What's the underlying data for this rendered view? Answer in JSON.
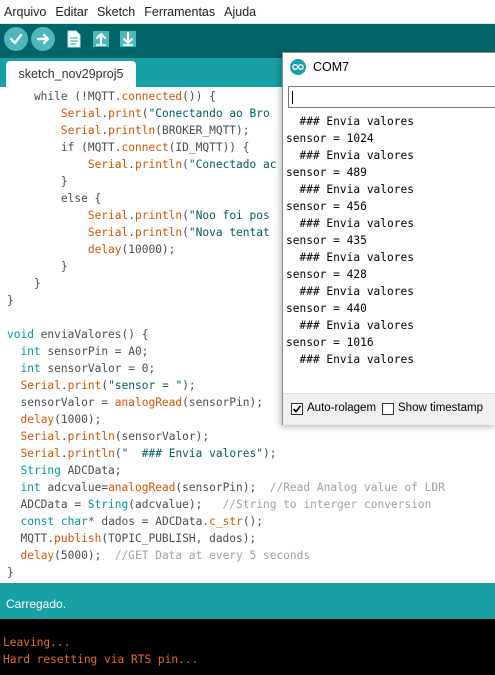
{
  "menu": [
    "Arquivo",
    "Editar",
    "Sketch",
    "Ferramentas",
    "Ajuda"
  ],
  "toolbar": {
    "verify_icon": "check-icon",
    "upload_icon": "arrow-right-icon",
    "new_icon": "document-icon",
    "open_icon": "arrow-up-icon",
    "save_icon": "arrow-down-icon"
  },
  "tab": {
    "label": "sketch_nov29proj5"
  },
  "code": [
    [
      [
        "    while (!",
        ""
      ],
      [
        "MQTT",
        "t"
      ],
      [
        ".",
        ""
      ],
      [
        "connected",
        "fn"
      ],
      [
        "()) {",
        ""
      ]
    ],
    [
      [
        "        ",
        ""
      ],
      [
        "Serial",
        "fn"
      ],
      [
        ".",
        ""
      ],
      [
        "print",
        "fn"
      ],
      [
        "(",
        ""
      ],
      [
        "\"Conectando ao Bro",
        "str"
      ]
    ],
    [
      [
        "        ",
        ""
      ],
      [
        "Serial",
        "fn"
      ],
      [
        ".",
        ""
      ],
      [
        "println",
        "fn"
      ],
      [
        "(BROKER_MQTT);",
        ""
      ]
    ],
    [
      [
        "        if (",
        ""
      ],
      [
        "MQTT",
        "t"
      ],
      [
        ".",
        ""
      ],
      [
        "connect",
        "fn"
      ],
      [
        "(ID_MQTT)) {",
        ""
      ]
    ],
    [
      [
        "            ",
        ""
      ],
      [
        "Serial",
        "fn"
      ],
      [
        ".",
        ""
      ],
      [
        "println",
        "fn"
      ],
      [
        "(",
        ""
      ],
      [
        "\"Conectado ac",
        "str"
      ]
    ],
    [
      [
        "        }",
        ""
      ]
    ],
    [
      [
        "        else {",
        ""
      ]
    ],
    [
      [
        "            ",
        ""
      ],
      [
        "Serial",
        "fn"
      ],
      [
        ".",
        ""
      ],
      [
        "println",
        "fn"
      ],
      [
        "(",
        ""
      ],
      [
        "\"Noo foi pos",
        "str"
      ]
    ],
    [
      [
        "            ",
        ""
      ],
      [
        "Serial",
        "fn"
      ],
      [
        ".",
        ""
      ],
      [
        "println",
        "fn"
      ],
      [
        "(",
        ""
      ],
      [
        "\"Nova tentat",
        "str"
      ]
    ],
    [
      [
        "            ",
        ""
      ],
      [
        "delay",
        "fn"
      ],
      [
        "(10000);",
        ""
      ]
    ],
    [
      [
        "        }",
        ""
      ]
    ],
    [
      [
        "    }",
        ""
      ]
    ],
    [
      [
        "}",
        ""
      ]
    ],
    [
      [
        "",
        ""
      ]
    ],
    [
      [
        "void",
        "kw"
      ],
      [
        " enviaValores() {",
        ""
      ]
    ],
    [
      [
        "  ",
        ""
      ],
      [
        "int",
        "kw"
      ],
      [
        " sensorPin = A0;",
        ""
      ]
    ],
    [
      [
        "  ",
        ""
      ],
      [
        "int",
        "kw"
      ],
      [
        " sensorValor = 0;",
        ""
      ]
    ],
    [
      [
        "  ",
        ""
      ],
      [
        "Serial",
        "fn"
      ],
      [
        ".",
        ""
      ],
      [
        "print",
        "fn"
      ],
      [
        "(",
        ""
      ],
      [
        "\"sensor = \"",
        "str"
      ],
      [
        ");",
        ""
      ]
    ],
    [
      [
        "  sensorValor = ",
        ""
      ],
      [
        "analogRead",
        "fn"
      ],
      [
        "(sensorPin);",
        ""
      ]
    ],
    [
      [
        "  ",
        ""
      ],
      [
        "delay",
        "fn"
      ],
      [
        "(1000);",
        ""
      ]
    ],
    [
      [
        "  ",
        ""
      ],
      [
        "Serial",
        "fn"
      ],
      [
        ".",
        ""
      ],
      [
        "println",
        "fn"
      ],
      [
        "(sensorValor);",
        ""
      ]
    ],
    [
      [
        "  ",
        ""
      ],
      [
        "Serial",
        "fn"
      ],
      [
        ".",
        ""
      ],
      [
        "println",
        "fn"
      ],
      [
        "(",
        ""
      ],
      [
        "\"  ### Envia valores\"",
        "str"
      ],
      [
        ");",
        ""
      ]
    ],
    [
      [
        "  ",
        ""
      ],
      [
        "String",
        "kw"
      ],
      [
        " ADCData;",
        ""
      ]
    ],
    [
      [
        "  ",
        ""
      ],
      [
        "int",
        "kw"
      ],
      [
        " adcvalue=",
        ""
      ],
      [
        "analogRead",
        "fn"
      ],
      [
        "(sensorPin);  ",
        ""
      ],
      [
        "//Read Analog value of LDR",
        "cm"
      ]
    ],
    [
      [
        "  ADCData = ",
        ""
      ],
      [
        "String",
        "kw"
      ],
      [
        "(adcvalue);   ",
        ""
      ],
      [
        "//String to interger conversion",
        "cm"
      ]
    ],
    [
      [
        "  ",
        ""
      ],
      [
        "const",
        "kw"
      ],
      [
        " ",
        ""
      ],
      [
        "char",
        "kw"
      ],
      [
        "* dados = ADCData.",
        ""
      ],
      [
        "c_str",
        "fn"
      ],
      [
        "();",
        ""
      ]
    ],
    [
      [
        "  MQTT.",
        ""
      ],
      [
        "publish",
        "fn"
      ],
      [
        "(TOPIC_PUBLISH, dados);",
        ""
      ]
    ],
    [
      [
        "  ",
        ""
      ],
      [
        "delay",
        "fn"
      ],
      [
        "(5000);  ",
        ""
      ],
      [
        "//GET Data at every 5 seconds",
        "cm"
      ]
    ],
    [
      [
        "}",
        ""
      ]
    ]
  ],
  "status": {
    "text": "Carregado."
  },
  "console": [
    "Leaving...",
    "Hard resetting via RTS pin..."
  ],
  "serial": {
    "title": "COM7",
    "input_value": "",
    "lines": [
      "  ### Envia valores",
      "sensor = 1024",
      "  ### Envia valores",
      "sensor = 489",
      "  ### Envia valores",
      "sensor = 456",
      "  ### Envia valores",
      "sensor = 435",
      "  ### Envia valores",
      "sensor = 428",
      "  ### Envia valores",
      "sensor = 440",
      "  ### Envia valores",
      "sensor = 1016",
      "  ### Envia valores"
    ],
    "autoscroll": {
      "label": "Auto-rolagem",
      "checked": true
    },
    "timestamp": {
      "label": "Show timestamp",
      "checked": false
    }
  },
  "colors": {
    "toolbar_bg": "#006468",
    "teal": "#17a1a5",
    "button": "#4db7bb",
    "keyword": "#00979c",
    "function": "#d35400",
    "string": "#005c5f",
    "comment": "#95a5a6",
    "console_text": "#e86a28"
  }
}
